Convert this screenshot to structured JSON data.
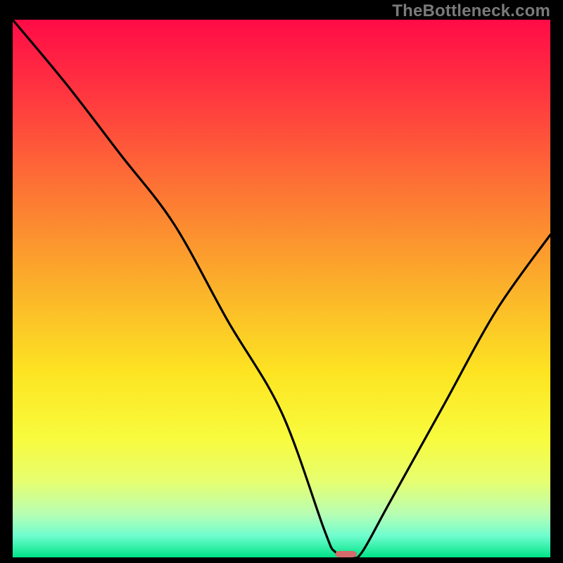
{
  "watermark": "TheBottleneck.com",
  "chart_data": {
    "type": "line",
    "title": "",
    "xlabel": "",
    "ylabel": "",
    "xlim": [
      0,
      100
    ],
    "ylim": [
      0,
      100
    ],
    "grid": false,
    "legend": false,
    "curve": {
      "name": "bottleneck-curve",
      "x": [
        0,
        10,
        20,
        30,
        40,
        50,
        58,
        60,
        63,
        65,
        70,
        80,
        90,
        100
      ],
      "y": [
        100,
        88,
        75,
        62,
        44,
        27,
        5,
        1,
        0,
        1,
        10,
        28,
        46,
        60
      ]
    },
    "marker": {
      "name": "optimum-marker",
      "x": 62,
      "y": 0,
      "width_pct": 4,
      "height_pct": 1.2,
      "color": "#d46a6a"
    },
    "gradient_stops": [
      {
        "offset": 0.0,
        "color": "#ff0b47"
      },
      {
        "offset": 0.15,
        "color": "#ff3a3f"
      },
      {
        "offset": 0.32,
        "color": "#fd7634"
      },
      {
        "offset": 0.5,
        "color": "#fbb22a"
      },
      {
        "offset": 0.66,
        "color": "#fde522"
      },
      {
        "offset": 0.78,
        "color": "#f8fb3e"
      },
      {
        "offset": 0.86,
        "color": "#e6fe71"
      },
      {
        "offset": 0.92,
        "color": "#b7feb4"
      },
      {
        "offset": 0.96,
        "color": "#6ffdcf"
      },
      {
        "offset": 1.0,
        "color": "#00e487"
      }
    ]
  }
}
